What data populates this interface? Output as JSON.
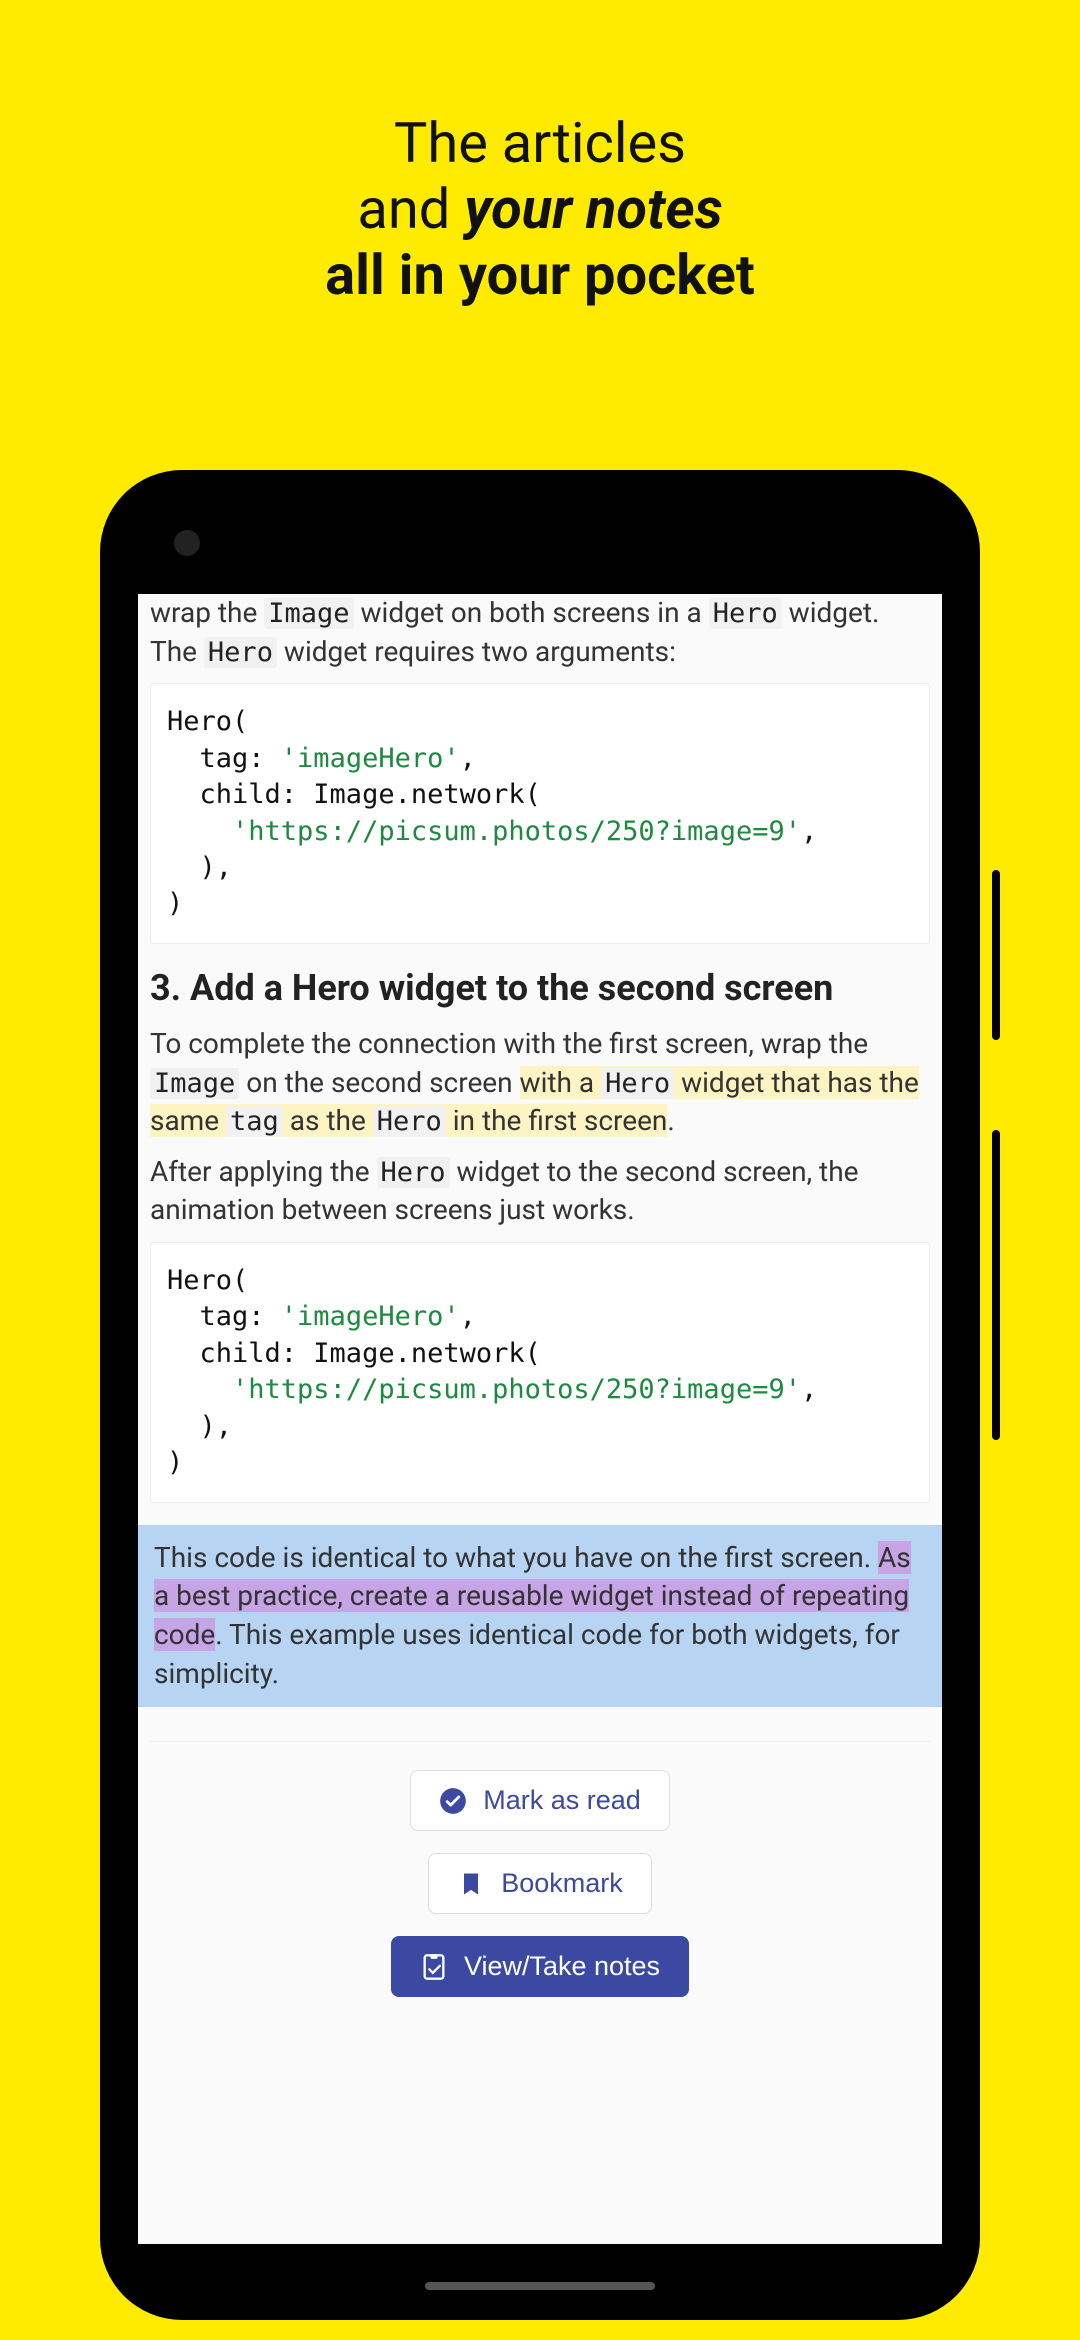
{
  "promo": {
    "line1": "The articles",
    "line2_pre": "and ",
    "line2_em": "your notes",
    "line3": "all in your pocket"
  },
  "article": {
    "intro": {
      "pre": "wrap the ",
      "c1": "Image",
      "mid": " widget on both screens in a ",
      "c2": "Hero",
      "after1": " widget. The ",
      "c3": "Hero",
      "after2": " widget requires two arguments:"
    },
    "code1": {
      "l1": "Hero(",
      "l2a": "  tag: ",
      "l2b": "'imageHero'",
      "l2c": ",",
      "l3": "  child: Image.network(",
      "l4a": "    ",
      "l4b": "'https://picsum.photos/250?image=9'",
      "l4c": ",",
      "l5": "  ),",
      "l6": ")"
    },
    "h3": "3. Add a Hero widget to the second screen",
    "p2": {
      "pre": "To complete the connection with the first screen, wrap the ",
      "c1": "Image",
      "mid1": " on the second screen ",
      "hl_a": "with a ",
      "c2": "Hero",
      "hl_b": " widget that has the same ",
      "c3": "tag",
      "hl_c": " as the ",
      "c4": "Hero",
      "hl_d": " in the first screen",
      "end": "."
    },
    "p3": {
      "pre": "After applying the ",
      "c1": "Hero",
      "post": " widget to the second screen, the animation between screens just works."
    },
    "info": {
      "pre": "This code is identical to what you have on the first screen. ",
      "hl": "As a best practice, create a reusable widget instead of repeating code",
      "post": ". This example uses identical code for both widgets, for simplicity."
    }
  },
  "buttons": {
    "mark_read": "Mark as read",
    "bookmark": "Bookmark",
    "notes": "View/Take notes"
  }
}
